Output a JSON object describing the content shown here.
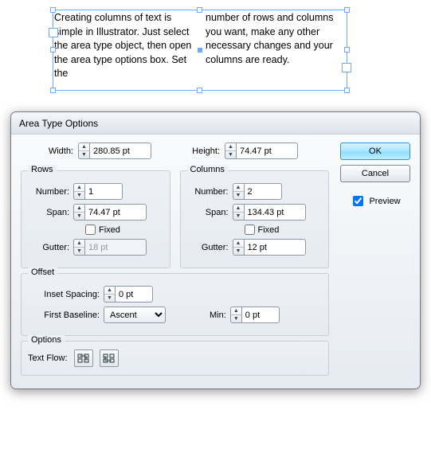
{
  "preview_text": {
    "col1": "Creating columns of text is simple in Illustrator. Just select the area type object, then open the area type options box. Set the",
    "col2": "number of rows and columns you want, make any other necessary changes and your columns are ready."
  },
  "dialog": {
    "title": "Area Type Options",
    "width_label": "Width:",
    "width_value": "280.85 pt",
    "height_label": "Height:",
    "height_value": "74.47 pt",
    "rows": {
      "legend": "Rows",
      "number_label": "Number:",
      "number_value": "1",
      "span_label": "Span:",
      "span_value": "74.47 pt",
      "fixed_label": "Fixed",
      "gutter_label": "Gutter:",
      "gutter_value": "18 pt"
    },
    "columns": {
      "legend": "Columns",
      "number_label": "Number:",
      "number_value": "2",
      "span_label": "Span:",
      "span_value": "134.43 pt",
      "fixed_label": "Fixed",
      "gutter_label": "Gutter:",
      "gutter_value": "12 pt"
    },
    "offset": {
      "legend": "Offset",
      "inset_label": "Inset Spacing:",
      "inset_value": "0 pt",
      "baseline_label": "First Baseline:",
      "baseline_value": "Ascent",
      "min_label": "Min:",
      "min_value": "0 pt"
    },
    "options": {
      "legend": "Options",
      "textflow_label": "Text Flow:"
    },
    "buttons": {
      "ok": "OK",
      "cancel": "Cancel",
      "preview": "Preview"
    }
  }
}
